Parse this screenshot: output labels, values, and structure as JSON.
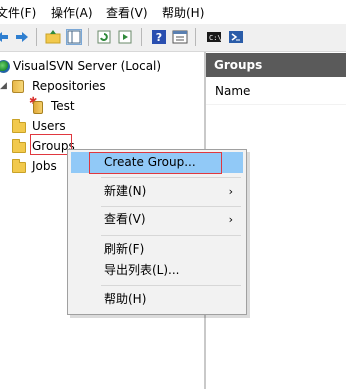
{
  "menubar": {
    "items": [
      "文件(F)",
      "操作(A)",
      "查看(V)",
      "帮助(H)"
    ]
  },
  "toolbar": {
    "buttons": [
      "back-icon",
      "forward-icon",
      "up-folder-icon",
      "show-tree-icon",
      "refresh-icon",
      "export-icon",
      "help-icon",
      "properties-icon",
      "console-icon",
      "powershell-icon"
    ]
  },
  "tree": {
    "root": "VisualSVN Server (Local)",
    "repositories": "Repositories",
    "test_repo": "Test",
    "users": "Users",
    "groups": "Groups",
    "jobs": "Jobs"
  },
  "right_pane": {
    "header": "Groups",
    "column": "Name"
  },
  "context_menu": {
    "create_group": "Create Group...",
    "new": "新建(N)",
    "view": "查看(V)",
    "refresh": "刷新(F)",
    "export_list": "导出列表(L)...",
    "help": "帮助(H)",
    "submenu_arrow": "›"
  },
  "colors": {
    "highlight": "#91c9f7",
    "annotation_red": "#e0383f",
    "header_bg": "#5a5a5a"
  }
}
